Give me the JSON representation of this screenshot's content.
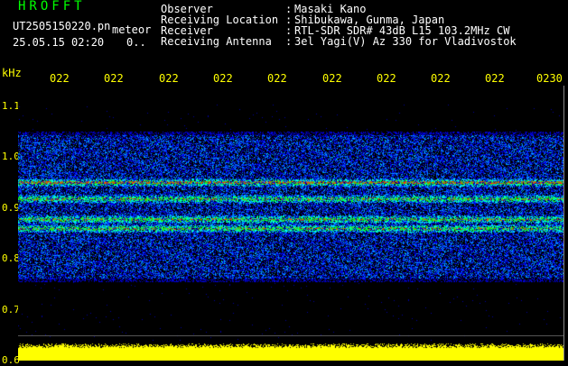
{
  "app": {
    "title": "HROFFT"
  },
  "file": {
    "name": "UT2505150220.pn",
    "type_label": "meteor",
    "datetime": "25.05.15 02:20",
    "extra": "0.."
  },
  "info": [
    {
      "label": "Observer",
      "value": "Masaki Kano"
    },
    {
      "label": "Receiving Location",
      "value": "Shibukawa, Gunma, Japan"
    },
    {
      "label": "Receiver",
      "value": "RTL-SDR SDR# 43dB L15 103.2MHz CW"
    },
    {
      "label": "Receiving Antenna",
      "value": "3el Yagi(V) Az 330 for Vladivostok"
    }
  ],
  "chart_data": {
    "type": "heatmap",
    "ylabel": "kHz",
    "x_ticks": [
      "022",
      "022",
      "022",
      "022",
      "022",
      "022",
      "022",
      "022",
      "022",
      "0230"
    ],
    "y_ticks": [
      "1.1",
      "1.0",
      "0.9",
      "0.8",
      "0.7",
      "0.6"
    ],
    "ylim": [
      0.6,
      1.14
    ],
    "signal_band_khz": [
      0.755,
      1.05
    ],
    "strong_lines_khz": [
      0.95,
      0.878,
      0.86,
      0.918
    ],
    "colors": {
      "background": "#000000",
      "low": "#0000ff",
      "mid": "#00ffff",
      "high": "#00ff00",
      "peak": "#ff0000",
      "level": "#ffff00"
    }
  }
}
